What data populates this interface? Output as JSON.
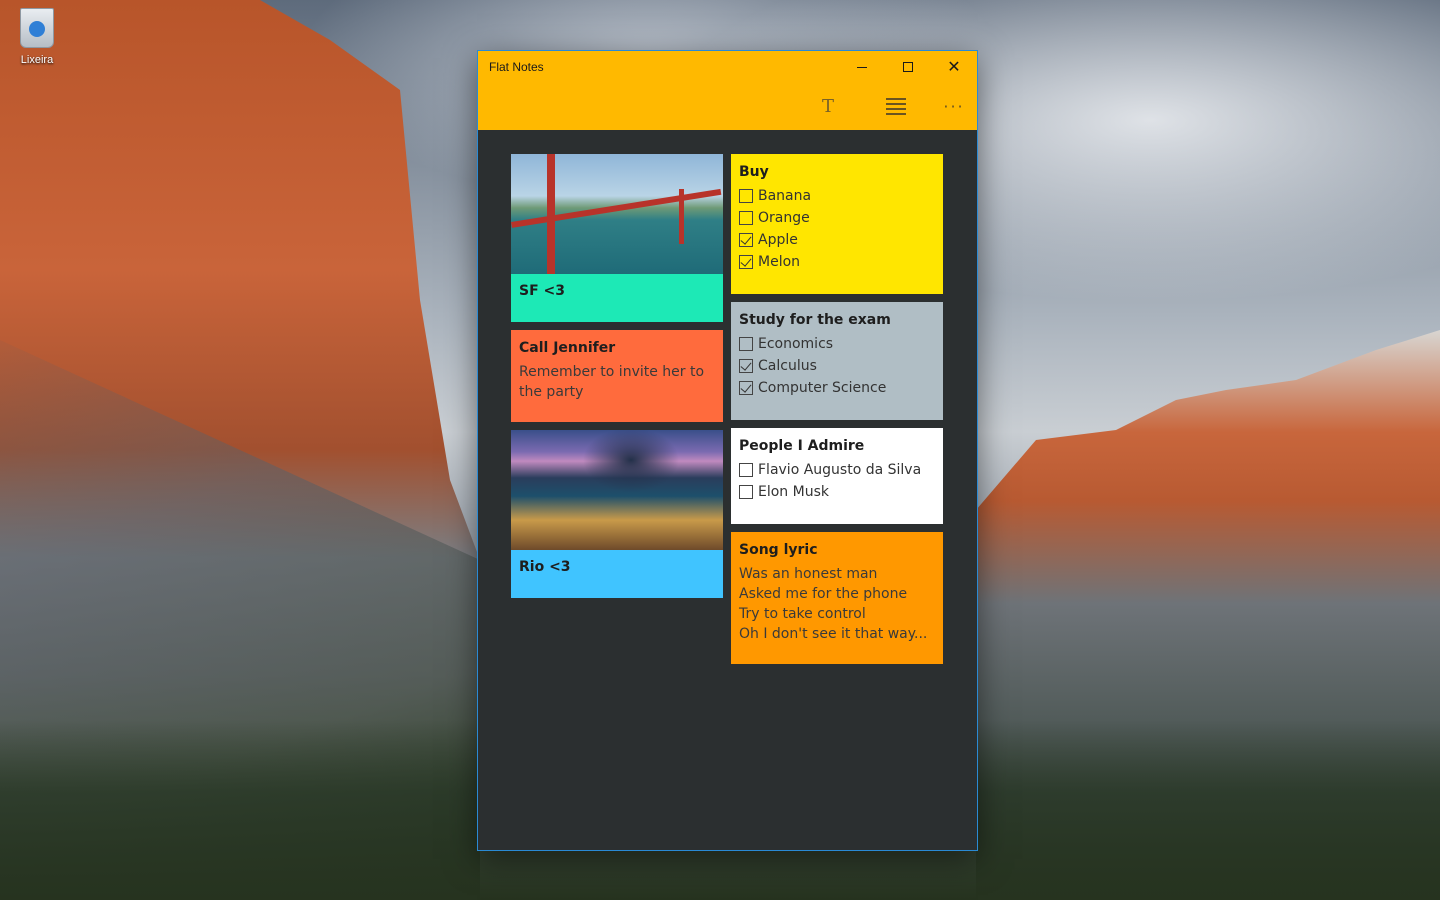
{
  "desktop": {
    "recycle_bin_label": "Lixeira"
  },
  "window": {
    "title": "Flat Notes",
    "accent_color": "#ffb900",
    "toolbar": {
      "text_icon": "T",
      "more_icon": "···"
    }
  },
  "notes": {
    "left": [
      {
        "type": "image",
        "title": "SF <3",
        "color": "#1de9b6",
        "image": "golden-gate-bridge"
      },
      {
        "type": "text",
        "title": "Call Jennifer",
        "text": "Remember to invite her to the party",
        "color": "#ff6b3d"
      },
      {
        "type": "image",
        "title": "Rio <3",
        "color": "#40c4ff",
        "image": "rio-de-janeiro"
      }
    ],
    "right": [
      {
        "type": "checklist",
        "title": "Buy",
        "color": "#ffe600",
        "items": [
          {
            "label": "Banana",
            "checked": false
          },
          {
            "label": "Orange",
            "checked": false
          },
          {
            "label": "Apple",
            "checked": true
          },
          {
            "label": "Melon",
            "checked": true
          }
        ]
      },
      {
        "type": "checklist",
        "title": "Study for the exam",
        "color": "#b0bec5",
        "items": [
          {
            "label": "Economics",
            "checked": false
          },
          {
            "label": "Calculus",
            "checked": true
          },
          {
            "label": "Computer Science",
            "checked": true
          }
        ]
      },
      {
        "type": "checklist",
        "title": "People I Admire",
        "color": "#ffffff",
        "items": [
          {
            "label": "Flavio Augusto da Silva",
            "checked": false
          },
          {
            "label": "Elon Musk",
            "checked": false
          }
        ]
      },
      {
        "type": "text",
        "title": "Song lyric",
        "color": "#ff9800",
        "lines": [
          "Was an honest man",
          "Asked me for the phone",
          "Try to take control",
          "Oh I don't see it that way..."
        ]
      }
    ]
  }
}
